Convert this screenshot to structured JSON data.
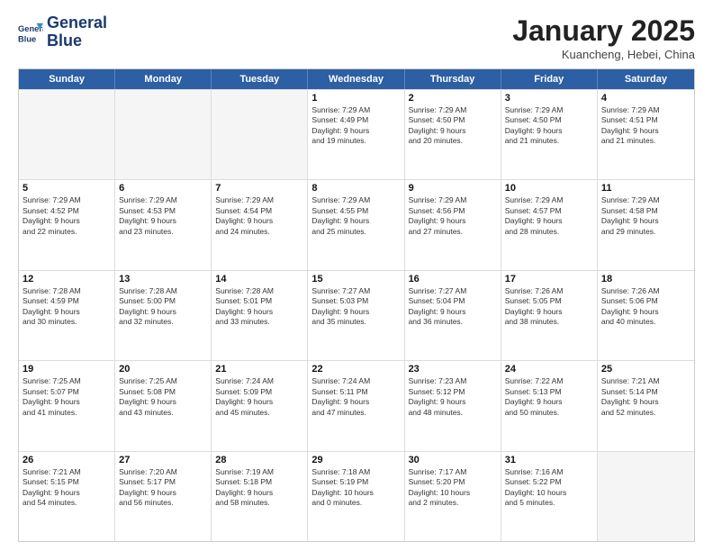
{
  "logo": {
    "line1": "General",
    "line2": "Blue"
  },
  "header": {
    "month": "January 2025",
    "location": "Kuancheng, Hebei, China"
  },
  "weekdays": [
    "Sunday",
    "Monday",
    "Tuesday",
    "Wednesday",
    "Thursday",
    "Friday",
    "Saturday"
  ],
  "weeks": [
    [
      {
        "day": "",
        "empty": true,
        "lines": []
      },
      {
        "day": "",
        "empty": true,
        "lines": []
      },
      {
        "day": "",
        "empty": true,
        "lines": []
      },
      {
        "day": "1",
        "empty": false,
        "lines": [
          "Sunrise: 7:29 AM",
          "Sunset: 4:49 PM",
          "Daylight: 9 hours",
          "and 19 minutes."
        ]
      },
      {
        "day": "2",
        "empty": false,
        "lines": [
          "Sunrise: 7:29 AM",
          "Sunset: 4:50 PM",
          "Daylight: 9 hours",
          "and 20 minutes."
        ]
      },
      {
        "day": "3",
        "empty": false,
        "lines": [
          "Sunrise: 7:29 AM",
          "Sunset: 4:50 PM",
          "Daylight: 9 hours",
          "and 21 minutes."
        ]
      },
      {
        "day": "4",
        "empty": false,
        "lines": [
          "Sunrise: 7:29 AM",
          "Sunset: 4:51 PM",
          "Daylight: 9 hours",
          "and 21 minutes."
        ]
      }
    ],
    [
      {
        "day": "5",
        "empty": false,
        "lines": [
          "Sunrise: 7:29 AM",
          "Sunset: 4:52 PM",
          "Daylight: 9 hours",
          "and 22 minutes."
        ]
      },
      {
        "day": "6",
        "empty": false,
        "lines": [
          "Sunrise: 7:29 AM",
          "Sunset: 4:53 PM",
          "Daylight: 9 hours",
          "and 23 minutes."
        ]
      },
      {
        "day": "7",
        "empty": false,
        "lines": [
          "Sunrise: 7:29 AM",
          "Sunset: 4:54 PM",
          "Daylight: 9 hours",
          "and 24 minutes."
        ]
      },
      {
        "day": "8",
        "empty": false,
        "lines": [
          "Sunrise: 7:29 AM",
          "Sunset: 4:55 PM",
          "Daylight: 9 hours",
          "and 25 minutes."
        ]
      },
      {
        "day": "9",
        "empty": false,
        "lines": [
          "Sunrise: 7:29 AM",
          "Sunset: 4:56 PM",
          "Daylight: 9 hours",
          "and 27 minutes."
        ]
      },
      {
        "day": "10",
        "empty": false,
        "lines": [
          "Sunrise: 7:29 AM",
          "Sunset: 4:57 PM",
          "Daylight: 9 hours",
          "and 28 minutes."
        ]
      },
      {
        "day": "11",
        "empty": false,
        "lines": [
          "Sunrise: 7:29 AM",
          "Sunset: 4:58 PM",
          "Daylight: 9 hours",
          "and 29 minutes."
        ]
      }
    ],
    [
      {
        "day": "12",
        "empty": false,
        "lines": [
          "Sunrise: 7:28 AM",
          "Sunset: 4:59 PM",
          "Daylight: 9 hours",
          "and 30 minutes."
        ]
      },
      {
        "day": "13",
        "empty": false,
        "lines": [
          "Sunrise: 7:28 AM",
          "Sunset: 5:00 PM",
          "Daylight: 9 hours",
          "and 32 minutes."
        ]
      },
      {
        "day": "14",
        "empty": false,
        "lines": [
          "Sunrise: 7:28 AM",
          "Sunset: 5:01 PM",
          "Daylight: 9 hours",
          "and 33 minutes."
        ]
      },
      {
        "day": "15",
        "empty": false,
        "lines": [
          "Sunrise: 7:27 AM",
          "Sunset: 5:03 PM",
          "Daylight: 9 hours",
          "and 35 minutes."
        ]
      },
      {
        "day": "16",
        "empty": false,
        "lines": [
          "Sunrise: 7:27 AM",
          "Sunset: 5:04 PM",
          "Daylight: 9 hours",
          "and 36 minutes."
        ]
      },
      {
        "day": "17",
        "empty": false,
        "lines": [
          "Sunrise: 7:26 AM",
          "Sunset: 5:05 PM",
          "Daylight: 9 hours",
          "and 38 minutes."
        ]
      },
      {
        "day": "18",
        "empty": false,
        "lines": [
          "Sunrise: 7:26 AM",
          "Sunset: 5:06 PM",
          "Daylight: 9 hours",
          "and 40 minutes."
        ]
      }
    ],
    [
      {
        "day": "19",
        "empty": false,
        "lines": [
          "Sunrise: 7:25 AM",
          "Sunset: 5:07 PM",
          "Daylight: 9 hours",
          "and 41 minutes."
        ]
      },
      {
        "day": "20",
        "empty": false,
        "lines": [
          "Sunrise: 7:25 AM",
          "Sunset: 5:08 PM",
          "Daylight: 9 hours",
          "and 43 minutes."
        ]
      },
      {
        "day": "21",
        "empty": false,
        "lines": [
          "Sunrise: 7:24 AM",
          "Sunset: 5:09 PM",
          "Daylight: 9 hours",
          "and 45 minutes."
        ]
      },
      {
        "day": "22",
        "empty": false,
        "lines": [
          "Sunrise: 7:24 AM",
          "Sunset: 5:11 PM",
          "Daylight: 9 hours",
          "and 47 minutes."
        ]
      },
      {
        "day": "23",
        "empty": false,
        "lines": [
          "Sunrise: 7:23 AM",
          "Sunset: 5:12 PM",
          "Daylight: 9 hours",
          "and 48 minutes."
        ]
      },
      {
        "day": "24",
        "empty": false,
        "lines": [
          "Sunrise: 7:22 AM",
          "Sunset: 5:13 PM",
          "Daylight: 9 hours",
          "and 50 minutes."
        ]
      },
      {
        "day": "25",
        "empty": false,
        "lines": [
          "Sunrise: 7:21 AM",
          "Sunset: 5:14 PM",
          "Daylight: 9 hours",
          "and 52 minutes."
        ]
      }
    ],
    [
      {
        "day": "26",
        "empty": false,
        "lines": [
          "Sunrise: 7:21 AM",
          "Sunset: 5:15 PM",
          "Daylight: 9 hours",
          "and 54 minutes."
        ]
      },
      {
        "day": "27",
        "empty": false,
        "lines": [
          "Sunrise: 7:20 AM",
          "Sunset: 5:17 PM",
          "Daylight: 9 hours",
          "and 56 minutes."
        ]
      },
      {
        "day": "28",
        "empty": false,
        "lines": [
          "Sunrise: 7:19 AM",
          "Sunset: 5:18 PM",
          "Daylight: 9 hours",
          "and 58 minutes."
        ]
      },
      {
        "day": "29",
        "empty": false,
        "lines": [
          "Sunrise: 7:18 AM",
          "Sunset: 5:19 PM",
          "Daylight: 10 hours",
          "and 0 minutes."
        ]
      },
      {
        "day": "30",
        "empty": false,
        "lines": [
          "Sunrise: 7:17 AM",
          "Sunset: 5:20 PM",
          "Daylight: 10 hours",
          "and 2 minutes."
        ]
      },
      {
        "day": "31",
        "empty": false,
        "lines": [
          "Sunrise: 7:16 AM",
          "Sunset: 5:22 PM",
          "Daylight: 10 hours",
          "and 5 minutes."
        ]
      },
      {
        "day": "",
        "empty": true,
        "lines": []
      }
    ]
  ]
}
